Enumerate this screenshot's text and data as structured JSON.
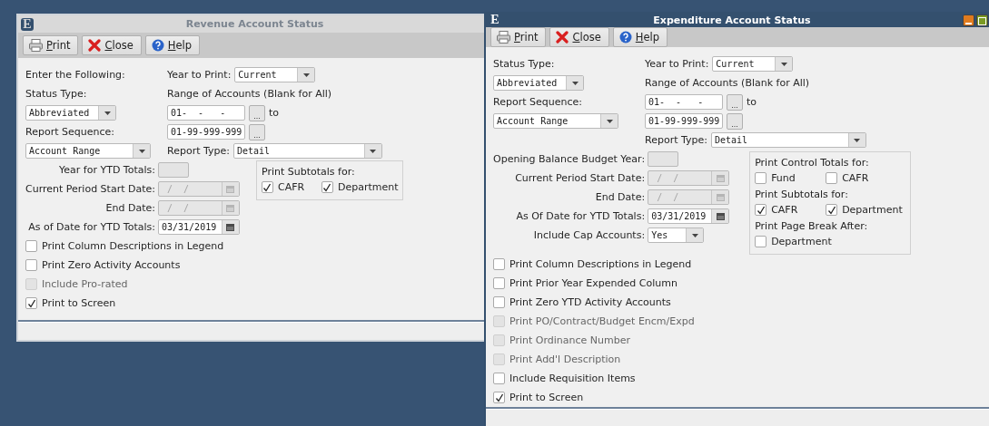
{
  "windows": [
    {
      "title": "Revenue Account Status",
      "active": false,
      "icon": "E",
      "toolbar": [
        "Print",
        "Close",
        "Help"
      ],
      "intro": "Enter the Following:",
      "status_type": {
        "label": "Status Type:",
        "value": "Abbreviated"
      },
      "report_sequence": {
        "label": "Report Sequence:",
        "value": "Account Range"
      },
      "year_to_print": {
        "label": "Year to Print:",
        "value": "Current"
      },
      "range": {
        "label": "Range of Accounts (Blank for All)",
        "from": "01-  -   -",
        "to_label": "to",
        "to": "01-99-999-999",
        "browse": "..."
      },
      "report_type": {
        "label": "Report Type:",
        "value": "Detail"
      },
      "date_fields": [
        {
          "kind": "year",
          "label": "Year for YTD Totals:",
          "disabled": true
        },
        {
          "kind": "date",
          "label": "Current Period Start Date:",
          "placeholder": " /  /",
          "disabled": true
        },
        {
          "kind": "date",
          "label": "End Date:",
          "placeholder": " /  /",
          "disabled": true
        },
        {
          "kind": "date",
          "label": "As of Date for YTD Totals:",
          "value": "03/31/2019",
          "disabled": false
        }
      ],
      "option_groups": [
        {
          "heading": "Print Subtotals for:",
          "items": [
            {
              "label": "CAFR",
              "checked": true
            },
            {
              "label": "Department",
              "checked": true
            }
          ]
        }
      ],
      "options": [
        {
          "label": "Print Column Descriptions in Legend",
          "checked": false,
          "disabled": false
        },
        {
          "label": "Print Zero Activity Accounts",
          "checked": false,
          "disabled": false
        },
        {
          "label": "Include Pro-rated",
          "checked": false,
          "disabled": true
        },
        {
          "label": "Print to Screen",
          "checked": true,
          "disabled": false
        }
      ]
    },
    {
      "title": "Expenditure Account Status",
      "active": true,
      "icon": "E",
      "toolbar": [
        "Print",
        "Close",
        "Help"
      ],
      "status_type": {
        "label": "Status Type:",
        "value": "Abbreviated"
      },
      "report_sequence": {
        "label": "Report Sequence:",
        "value": "Account Range"
      },
      "year_to_print": {
        "label": "Year to Print:",
        "value": "Current"
      },
      "range": {
        "label": "Range of Accounts (Blank for All)",
        "from": "01-  -   -",
        "to_label": "to",
        "to": "01-99-999-999",
        "browse": "..."
      },
      "report_type": {
        "label": "Report Type:",
        "value": "Detail"
      },
      "date_fields": [
        {
          "kind": "year",
          "label": "Opening Balance Budget Year:",
          "disabled": true
        },
        {
          "kind": "date",
          "label": "Current Period Start Date:",
          "placeholder": " /  /",
          "disabled": true
        },
        {
          "kind": "date",
          "label": "End Date:",
          "placeholder": " /  /",
          "disabled": true
        },
        {
          "kind": "date",
          "label": "As Of Date for YTD Totals:",
          "value": "03/31/2019",
          "disabled": false
        },
        {
          "kind": "dropdown",
          "label": "Include Cap Accounts:",
          "value": "Yes",
          "disabled": false
        }
      ],
      "option_groups": [
        {
          "heading": "Print Control Totals for:",
          "items": [
            {
              "label": "Fund",
              "checked": false
            },
            {
              "label": "CAFR",
              "checked": false
            }
          ]
        },
        {
          "heading": "Print Subtotals for:",
          "items": [
            {
              "label": "CAFR",
              "checked": true
            },
            {
              "label": "Department",
              "checked": true
            }
          ]
        },
        {
          "heading": "Print Page Break After:",
          "items": [
            {
              "label": "Department",
              "checked": false
            }
          ]
        }
      ],
      "options": [
        {
          "label": "Print Column Descriptions in Legend",
          "checked": false,
          "disabled": false
        },
        {
          "label": "Print Prior Year Expended Column",
          "checked": false,
          "disabled": false
        },
        {
          "label": "Print Zero YTD Activity Accounts",
          "checked": false,
          "disabled": false
        },
        {
          "label": "Print PO/Contract/Budget Encm/Expd",
          "checked": false,
          "disabled": true
        },
        {
          "label": "Print Ordinance Number",
          "checked": false,
          "disabled": true
        },
        {
          "label": "Print Add'l Description",
          "checked": false,
          "disabled": true
        },
        {
          "label": "Include Requisition Items",
          "checked": false,
          "disabled": false
        },
        {
          "label": "Print to Screen",
          "checked": true,
          "disabled": false
        }
      ]
    }
  ]
}
